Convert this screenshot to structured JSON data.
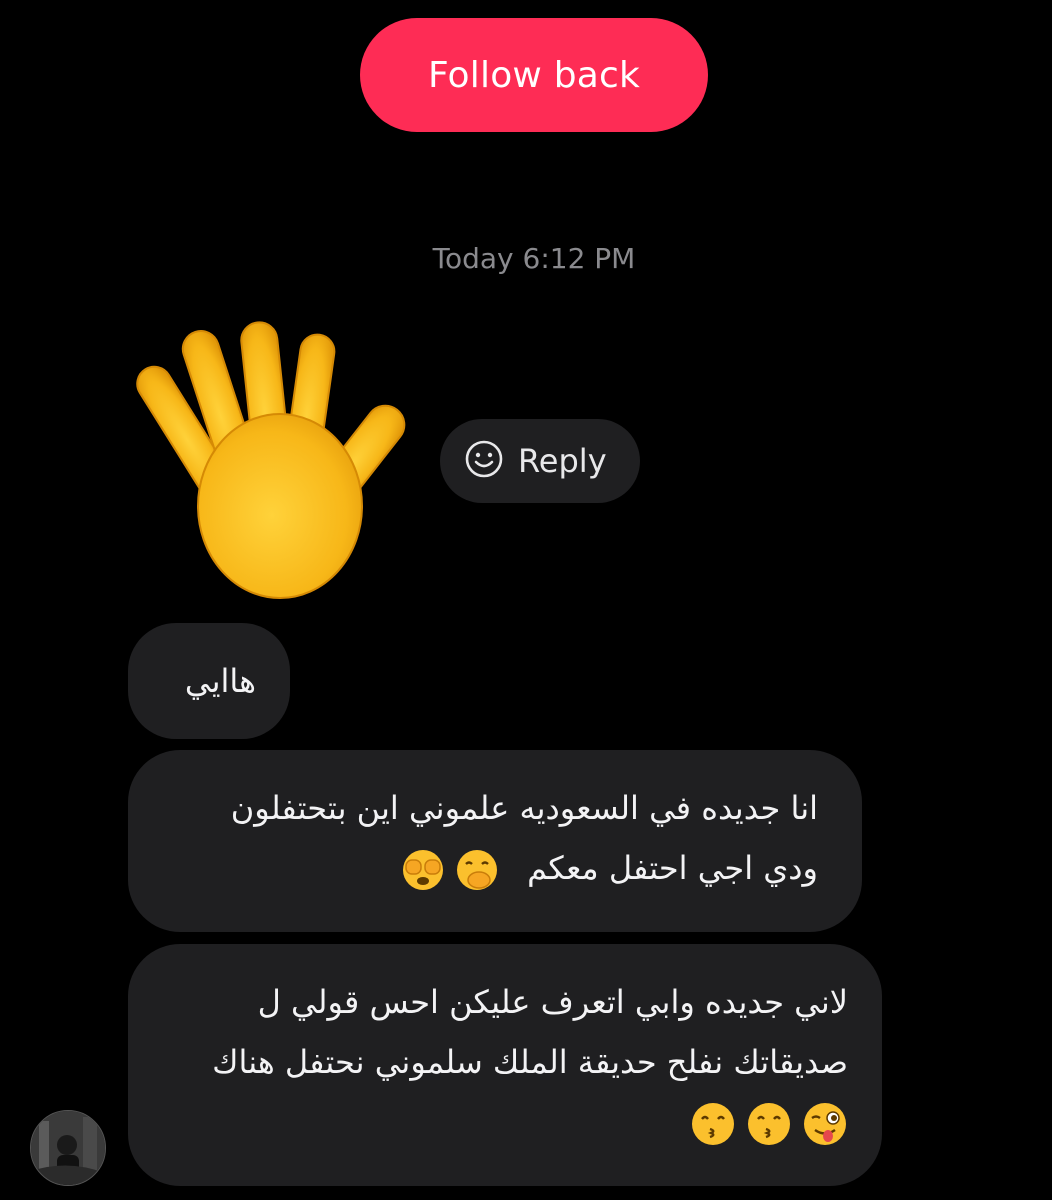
{
  "header": {
    "follow_back_label": "Follow back"
  },
  "chat": {
    "timestamp": "Today 6:12 PM",
    "reply_label": "Reply",
    "messages": [
      {
        "lines": [
          "هاايي"
        ]
      },
      {
        "lines": [
          "انا جديده في السعوديه علموني اين بتحتفلون",
          "ودي اجي احتفل معكم"
        ],
        "emojis": [
          "hand-over-mouth-emoji",
          "see-no-evil-face-emoji"
        ]
      },
      {
        "lines": [
          "لاني جديده وابي اتعرف عليكن احس قولي ل",
          "صديقاتك نفلح حديقة الملك سلموني نحتفل هناك"
        ],
        "emojis": [
          "winking-tongue-face-emoji",
          "kissing-face-emoji",
          "kissing-face-emoji"
        ]
      }
    ]
  },
  "colors": {
    "background": "#000000",
    "follow_button": "#fe2c55",
    "bubble": "#1f1f21",
    "timestamp": "#8a8a8e"
  },
  "icons": {
    "wave": "raised-hand-emoji",
    "reply": "smiley-icon"
  }
}
